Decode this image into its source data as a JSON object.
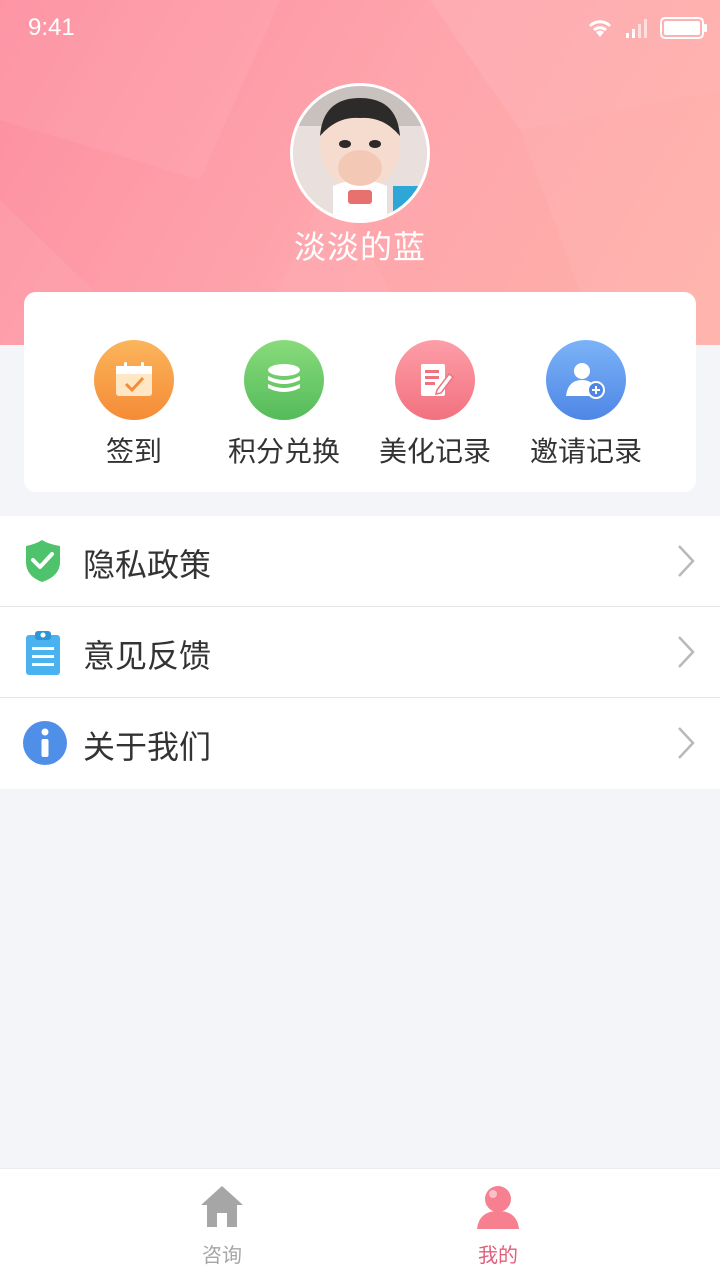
{
  "status_bar": {
    "time": "9:41"
  },
  "profile": {
    "username": "淡淡的蓝"
  },
  "quick_actions": [
    {
      "label": "签到",
      "icon": "calendar-check-icon",
      "color": "#f79a3c"
    },
    {
      "label": "积分兑换",
      "icon": "coin-stack-icon",
      "color": "#6cc96a"
    },
    {
      "label": "美化记录",
      "icon": "edit-note-icon",
      "color": "#f98593"
    },
    {
      "label": "邀请记录",
      "icon": "add-user-icon",
      "color": "#5e98ee"
    }
  ],
  "menu": [
    {
      "label": "隐私政策",
      "icon": "shield-check-icon"
    },
    {
      "label": "意见反馈",
      "icon": "clipboard-icon"
    },
    {
      "label": "关于我们",
      "icon": "info-icon"
    }
  ],
  "tabs": [
    {
      "label": "咨询",
      "icon": "home-icon",
      "active": false
    },
    {
      "label": "我的",
      "icon": "user-icon",
      "active": true
    }
  ],
  "colors": {
    "accent": "#fd8fa0",
    "active_tab": "#f06f84",
    "inactive_tab": "#a6a6a6"
  }
}
